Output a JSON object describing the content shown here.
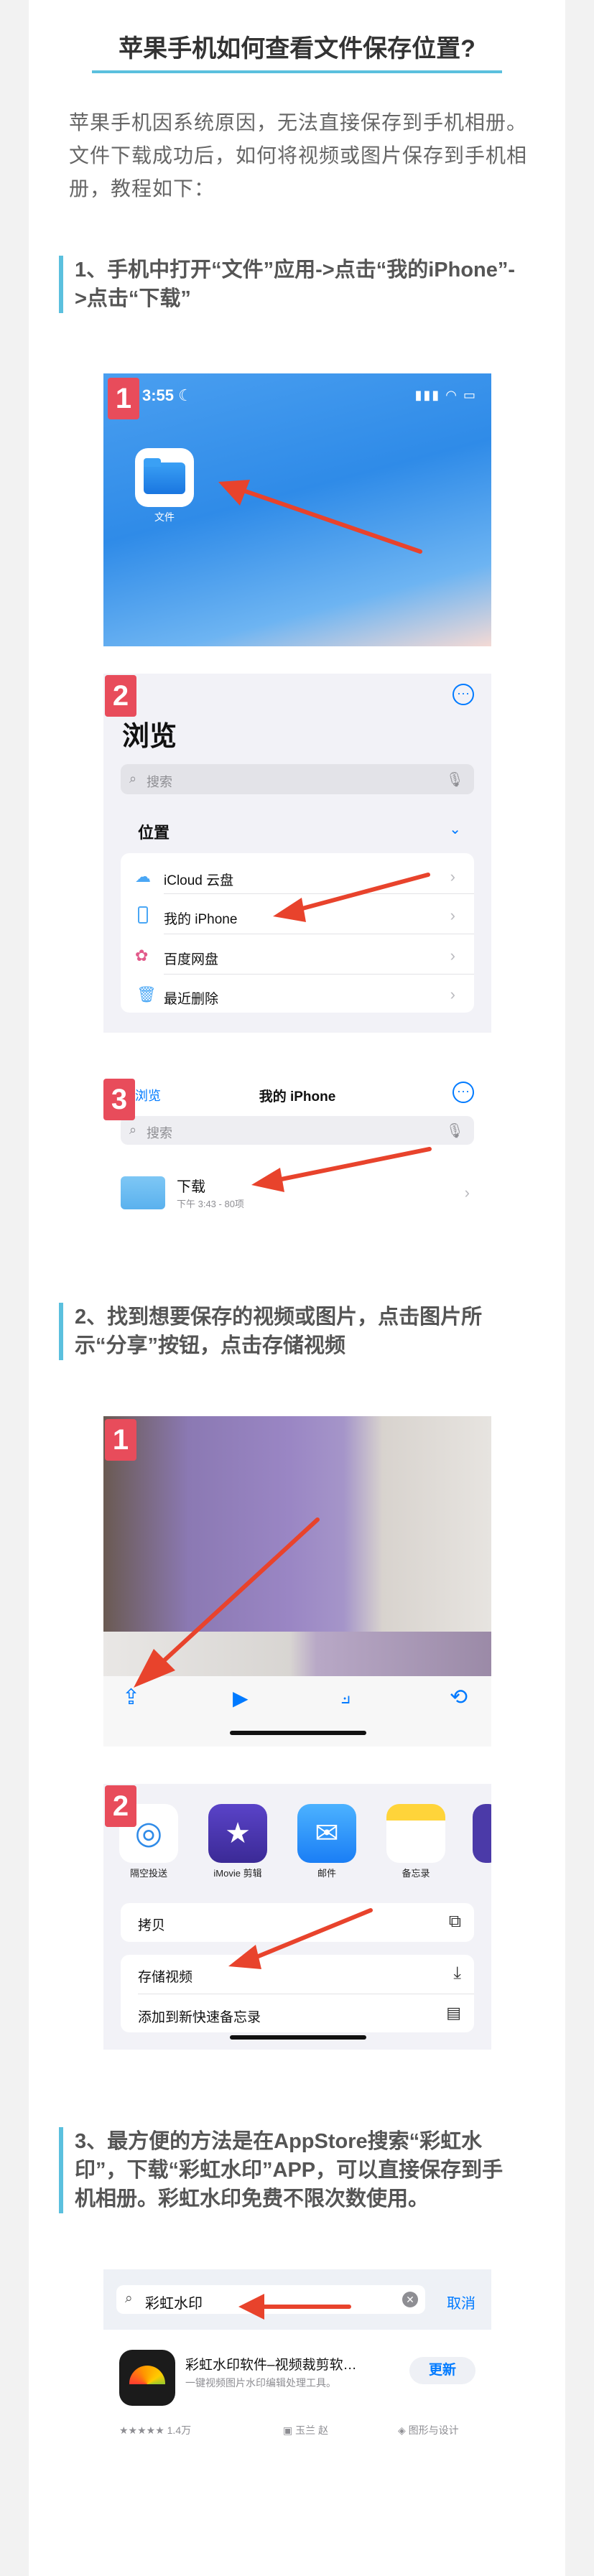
{
  "title": "苹果手机如何查看文件保存位置?",
  "intro": "苹果手机因系统原因，无法直接保存到手机相册。文件下载成功后，如何将视频或图片保存到手机相册，教程如下：",
  "steps": [
    {
      "text": "1、手机中打开“文件”应用->点击“我的iPhone”->点击“下载”"
    },
    {
      "text": "2、找到想要保存的视频或图片，点击图片所示“分享”按钮，点击存储视频"
    },
    {
      "text": "3、最方便的方法是在AppStore搜索“彩虹水印”，下载“彩虹水印”APP，可以直接保存到手机相册。彩虹水印免费不限次数使用。"
    }
  ],
  "badges": [
    "1",
    "2",
    "3"
  ],
  "home": {
    "time": "3:55",
    "files_label": "文件"
  },
  "browse": {
    "title": "浏览",
    "search_placeholder": "搜索",
    "section": "位置",
    "items": [
      {
        "label": "iCloud 云盘",
        "icon": "cloud-icon"
      },
      {
        "label": "我的 iPhone",
        "icon": "phone-icon"
      },
      {
        "label": "百度网盘",
        "icon": "baidu-icon"
      },
      {
        "label": "最近删除",
        "icon": "trash-icon"
      }
    ]
  },
  "myiphone": {
    "back": "浏览",
    "title": "我的 iPhone",
    "search_placeholder": "搜索",
    "folder": "下载",
    "folder_meta": "下午 3:43 - 80项"
  },
  "share": {
    "apps": [
      "隔空投送",
      "iMovie 剪辑",
      "邮件",
      "备忘录"
    ],
    "actions": [
      "拷贝",
      "存储视频",
      "添加到新快速备忘录"
    ]
  },
  "appstore": {
    "search_text": "彩虹水印",
    "cancel": "取消",
    "app_name": "彩虹水印软件–视频裁剪软…",
    "app_sub": "一键视频图片水印编辑处理工具。",
    "get": "更新",
    "rating": "★★★★★ 1.4万",
    "developer": "玉兰 赵",
    "category": "图形与设计"
  },
  "colors": {
    "accent": "#5bc0de",
    "badge": "#e84c5b",
    "arrow": "#e8432c",
    "ios_blue": "#007aff"
  }
}
